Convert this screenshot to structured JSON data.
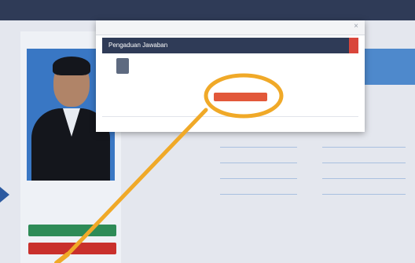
{
  "app": {
    "photo_frame_color": "#0f1014",
    "nav_color": "#2f3b57",
    "accent_blue": "#3977c4",
    "annotation_color": "#f0a928"
  },
  "sidebar": {
    "title": "",
    "profile_name": "",
    "buttons": {
      "primary_label": "",
      "primary_color": "#2e8b57",
      "danger_label": "",
      "danger_color": "#c9302c"
    }
  },
  "main": {
    "links_mid": [
      "",
      "",
      "",
      ""
    ],
    "links_right": [
      "",
      "",
      "",
      ""
    ],
    "bottom_label": "",
    "footer_label": "",
    "table_headers": [
      "",
      "",
      "",
      "",
      ""
    ]
  },
  "popup": {
    "window_title": "",
    "header": "Pengaduan Jawaban",
    "header_accent": "#d9463b",
    "message_line_1": "",
    "message_line_2": "",
    "message_line_3": "",
    "action_label": "",
    "action_color": "#e2583a"
  },
  "annotation": {
    "shape": "circle-with-arrow",
    "target": "popup-action-button"
  }
}
